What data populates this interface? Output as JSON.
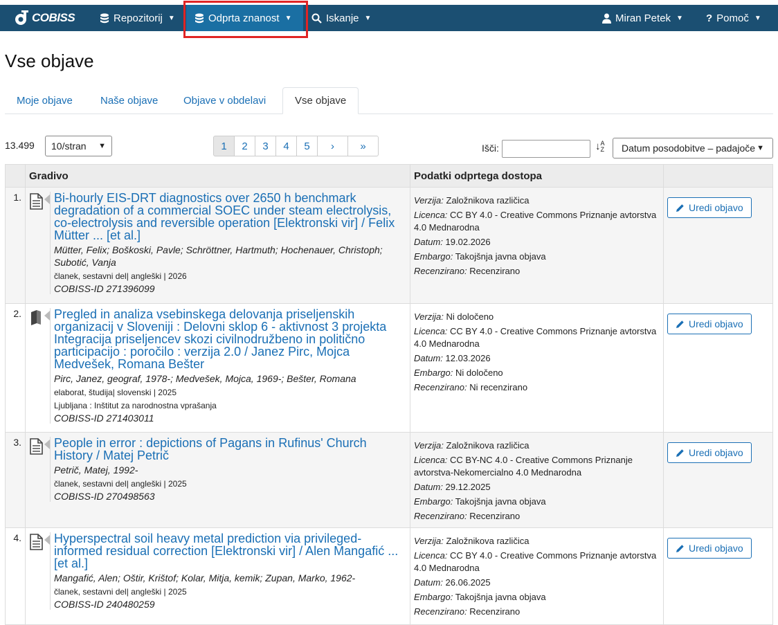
{
  "nav": {
    "brand": "COBISS",
    "items": [
      {
        "label": "Repozitorij",
        "icon": "database-icon"
      },
      {
        "label": "Odprta znanost",
        "icon": "database-icon"
      },
      {
        "label": "Iskanje",
        "icon": "search-icon"
      }
    ],
    "user": "Miran Petek",
    "help": "Pomoč"
  },
  "page_title": "Vse objave",
  "tabs": [
    "Moje objave",
    "Naše objave",
    "Objave v obdelavi",
    "Vse objave"
  ],
  "active_tab": "Vse objave",
  "toolbar": {
    "count": "13.499",
    "per_page": "10/stran",
    "pages": [
      "1",
      "2",
      "3",
      "4",
      "5",
      "›",
      "»"
    ],
    "current_page": "1",
    "search_label": "Išči:",
    "sort": "Datum posodobitve – padajoče"
  },
  "table": {
    "headers": [
      "Gradivo",
      "Podatki odprtega dostopa"
    ],
    "edit_label": "Uredi objavo",
    "labels": {
      "version": "Verzija:",
      "license": "Licenca:",
      "date": "Datum:",
      "embargo": "Embargo:",
      "review": "Recenzirano:"
    },
    "rows": [
      {
        "num": "1.",
        "icon": "document-icon",
        "title": "Bi-hourly EIS-DRT diagnostics over 2650 h benchmark degradation of a commercial SOEC under steam electrolysis, co-electrolysis and reversible operation [Elektronski vir] / Felix Mütter ... [et al.]",
        "authors": "Mütter, Felix; Boškoski, Pavle; Schröttner, Hartmuth; Hochenauer, Christoph; Subotić, Vanja",
        "meta": "članek, sestavni del| angleški | 2026",
        "publisher": "",
        "cobiss": "COBISS-ID 271396099",
        "version": "Založnikova različica",
        "license": "CC BY 4.0 - Creative Commons Priznanje avtorstva 4.0 Mednarodna",
        "date": "19.02.2026",
        "embargo": "Takojšnja javna objava",
        "review": "Recenzirano"
      },
      {
        "num": "2.",
        "icon": "book-icon",
        "title": "Pregled in analiza vsebinskega delovanja priseljenskih organizacij v Sloveniji : Delovni sklop 6 - aktivnost 3 projekta Integracija priseljencev skozi civilnodružbeno in politično participacijo : poročilo : verzija 2.0 / Janez Pirc, Mojca Medvešek, Romana Bešter",
        "authors": "Pirc, Janez, geograf, 1978-; Medvešek, Mojca, 1969-; Bešter, Romana",
        "meta": "elaborat, študija| slovenski | 2025",
        "publisher": "Ljubljana : Inštitut za narodnostna vprašanja",
        "cobiss": "COBISS-ID 271403011",
        "version": "Ni določeno",
        "license": "CC BY 4.0 - Creative Commons Priznanje avtorstva 4.0 Mednarodna",
        "date": "12.03.2026",
        "embargo": "Ni določeno",
        "review": "Ni recenzirano"
      },
      {
        "num": "3.",
        "icon": "document-icon",
        "title": "People in error : depictions of Pagans in Rufinus' Church History / Matej Petrič",
        "authors": "Petrič, Matej, 1992-",
        "meta": "članek, sestavni del| angleški | 2025",
        "publisher": "",
        "cobiss": "COBISS-ID 270498563",
        "version": "Založnikova različica",
        "license": "CC BY-NC 4.0 - Creative Commons Priznanje avtorstva-Nekomercialno 4.0 Mednarodna",
        "date": "29.12.2025",
        "embargo": "Takojšnja javna objava",
        "review": "Recenzirano"
      },
      {
        "num": "4.",
        "icon": "document-icon",
        "title": "Hyperspectral soil heavy metal prediction via privileged-informed residual correction [Elektronski vir] / Alen Mangafić ... [et al.]",
        "authors": "Mangafić, Alen; Oštir, Krištof; Kolar, Mitja, kemik; Zupan, Marko, 1962-",
        "meta": "članek, sestavni del| angleški | 2025",
        "publisher": "",
        "cobiss": "COBISS-ID 240480259",
        "version": "Založnikova različica",
        "license": "CC BY 4.0 - Creative Commons Priznanje avtorstva 4.0 Mednarodna",
        "date": "26.06.2025",
        "embargo": "Takojšnja javna objava",
        "review": "Recenzirano"
      }
    ]
  }
}
